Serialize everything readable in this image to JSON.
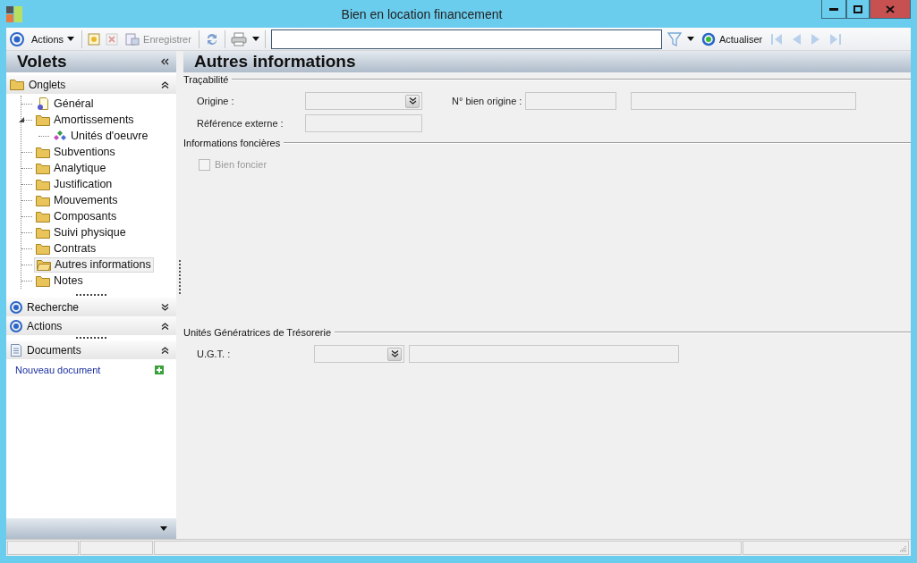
{
  "window": {
    "title": "Bien en location financement"
  },
  "toolbar": {
    "actions_label": "Actions",
    "save": {
      "label": "Enregistrer",
      "disabled": true
    },
    "delete_disabled": true,
    "refresh_label": "Actualiser",
    "navigation_disabled": true
  },
  "sidebar": {
    "title": "Volets",
    "sections": [
      {
        "kind": "tree",
        "title": "Onglets",
        "expanded": true,
        "items": [
          {
            "kind": "page",
            "label": "Général",
            "selected": false
          },
          {
            "kind": "folder",
            "label": "Amortissements",
            "selected": false,
            "expanded": true,
            "children": [
              {
                "kind": "gem",
                "label": "Unités d'oeuvre",
                "selected": false
              }
            ]
          },
          {
            "kind": "folder",
            "label": "Subventions",
            "selected": false
          },
          {
            "kind": "folder",
            "label": "Analytique",
            "selected": false
          },
          {
            "kind": "folder",
            "label": "Justification",
            "selected": false
          },
          {
            "kind": "folder",
            "label": "Mouvements",
            "selected": false
          },
          {
            "kind": "folder",
            "label": "Composants",
            "selected": false
          },
          {
            "kind": "folder",
            "label": "Suivi physique",
            "selected": false
          },
          {
            "kind": "folder",
            "label": "Contrats",
            "selected": false
          },
          {
            "kind": "folder",
            "label": "Autres informations",
            "selected": true
          },
          {
            "kind": "folder",
            "label": "Notes",
            "selected": false
          }
        ]
      },
      {
        "kind": "panel",
        "title": "Recherche",
        "expanded": false
      },
      {
        "kind": "panel",
        "title": "Actions",
        "expanded": true
      },
      {
        "kind": "documents",
        "title": "Documents",
        "expanded": true,
        "links": [
          "Nouveau document"
        ]
      }
    ]
  },
  "main": {
    "title": "Autres informations",
    "tracabilite": {
      "title": "Traçabilité",
      "origine_label": "Origine :",
      "numero_label": "N° bien origine :",
      "reference_label": "Référence externe :"
    },
    "foncier": {
      "title": "Informations foncières",
      "checkbox": {
        "label": "Bien foncier",
        "checked": false,
        "disabled": true
      }
    },
    "ugt": {
      "title": "Unités Génératrices de Trésorerie",
      "label": "U.G.T. :"
    }
  }
}
